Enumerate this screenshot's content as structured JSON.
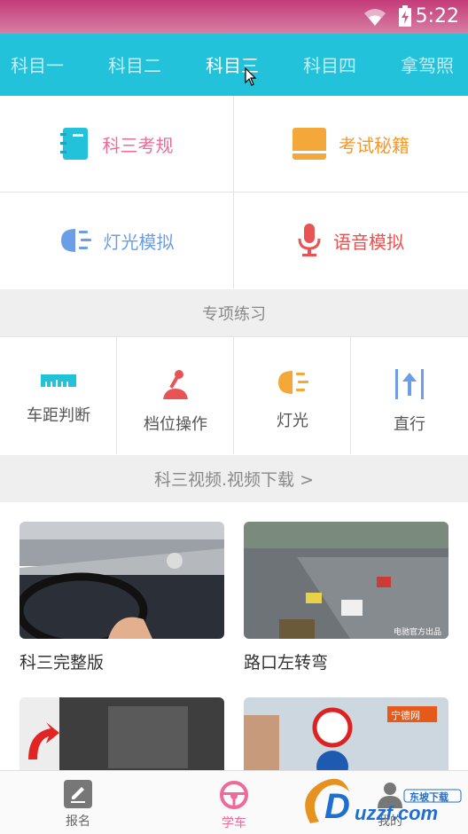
{
  "status": {
    "time": "5:22"
  },
  "tabs": [
    {
      "label": "科目一",
      "active": false
    },
    {
      "label": "科目二",
      "active": false
    },
    {
      "label": "科目三",
      "active": true
    },
    {
      "label": "科目四",
      "active": false
    },
    {
      "label": "拿驾照",
      "active": false
    }
  ],
  "grid": {
    "rules": {
      "label": "科三考规",
      "color": "#ee6a9a"
    },
    "tips": {
      "label": "考试秘籍",
      "color": "#f29a2e"
    },
    "light_sim": {
      "label": "灯光模拟",
      "color": "#6b9ee6"
    },
    "voice_sim": {
      "label": "语音模拟",
      "color": "#e85454"
    }
  },
  "special": {
    "title": "专项练习",
    "items": [
      {
        "label": "车距判断",
        "icon": "ruler-icon"
      },
      {
        "label": "档位操作",
        "icon": "gear-shift-icon"
      },
      {
        "label": "灯光",
        "icon": "headlight-icon"
      },
      {
        "label": "直行",
        "icon": "straight-arrow-icon"
      }
    ]
  },
  "videos": {
    "header": "科三视频.视频下载 >",
    "items": [
      {
        "title": "科三完整版"
      },
      {
        "title": "路口左转弯"
      }
    ],
    "thumb_caption": "电驰官方出品",
    "brand_badge": "宁德网"
  },
  "bottom_nav": [
    {
      "label": "报名",
      "active": false
    },
    {
      "label": "学车",
      "active": true
    },
    {
      "label": "我的",
      "active": false
    }
  ],
  "watermark": {
    "text": "uzzf.com",
    "subtitle": "东坡下载"
  },
  "colors": {
    "accent": "#22c2db",
    "status": "#c43b78",
    "nav_active": "#ee6a9a"
  }
}
